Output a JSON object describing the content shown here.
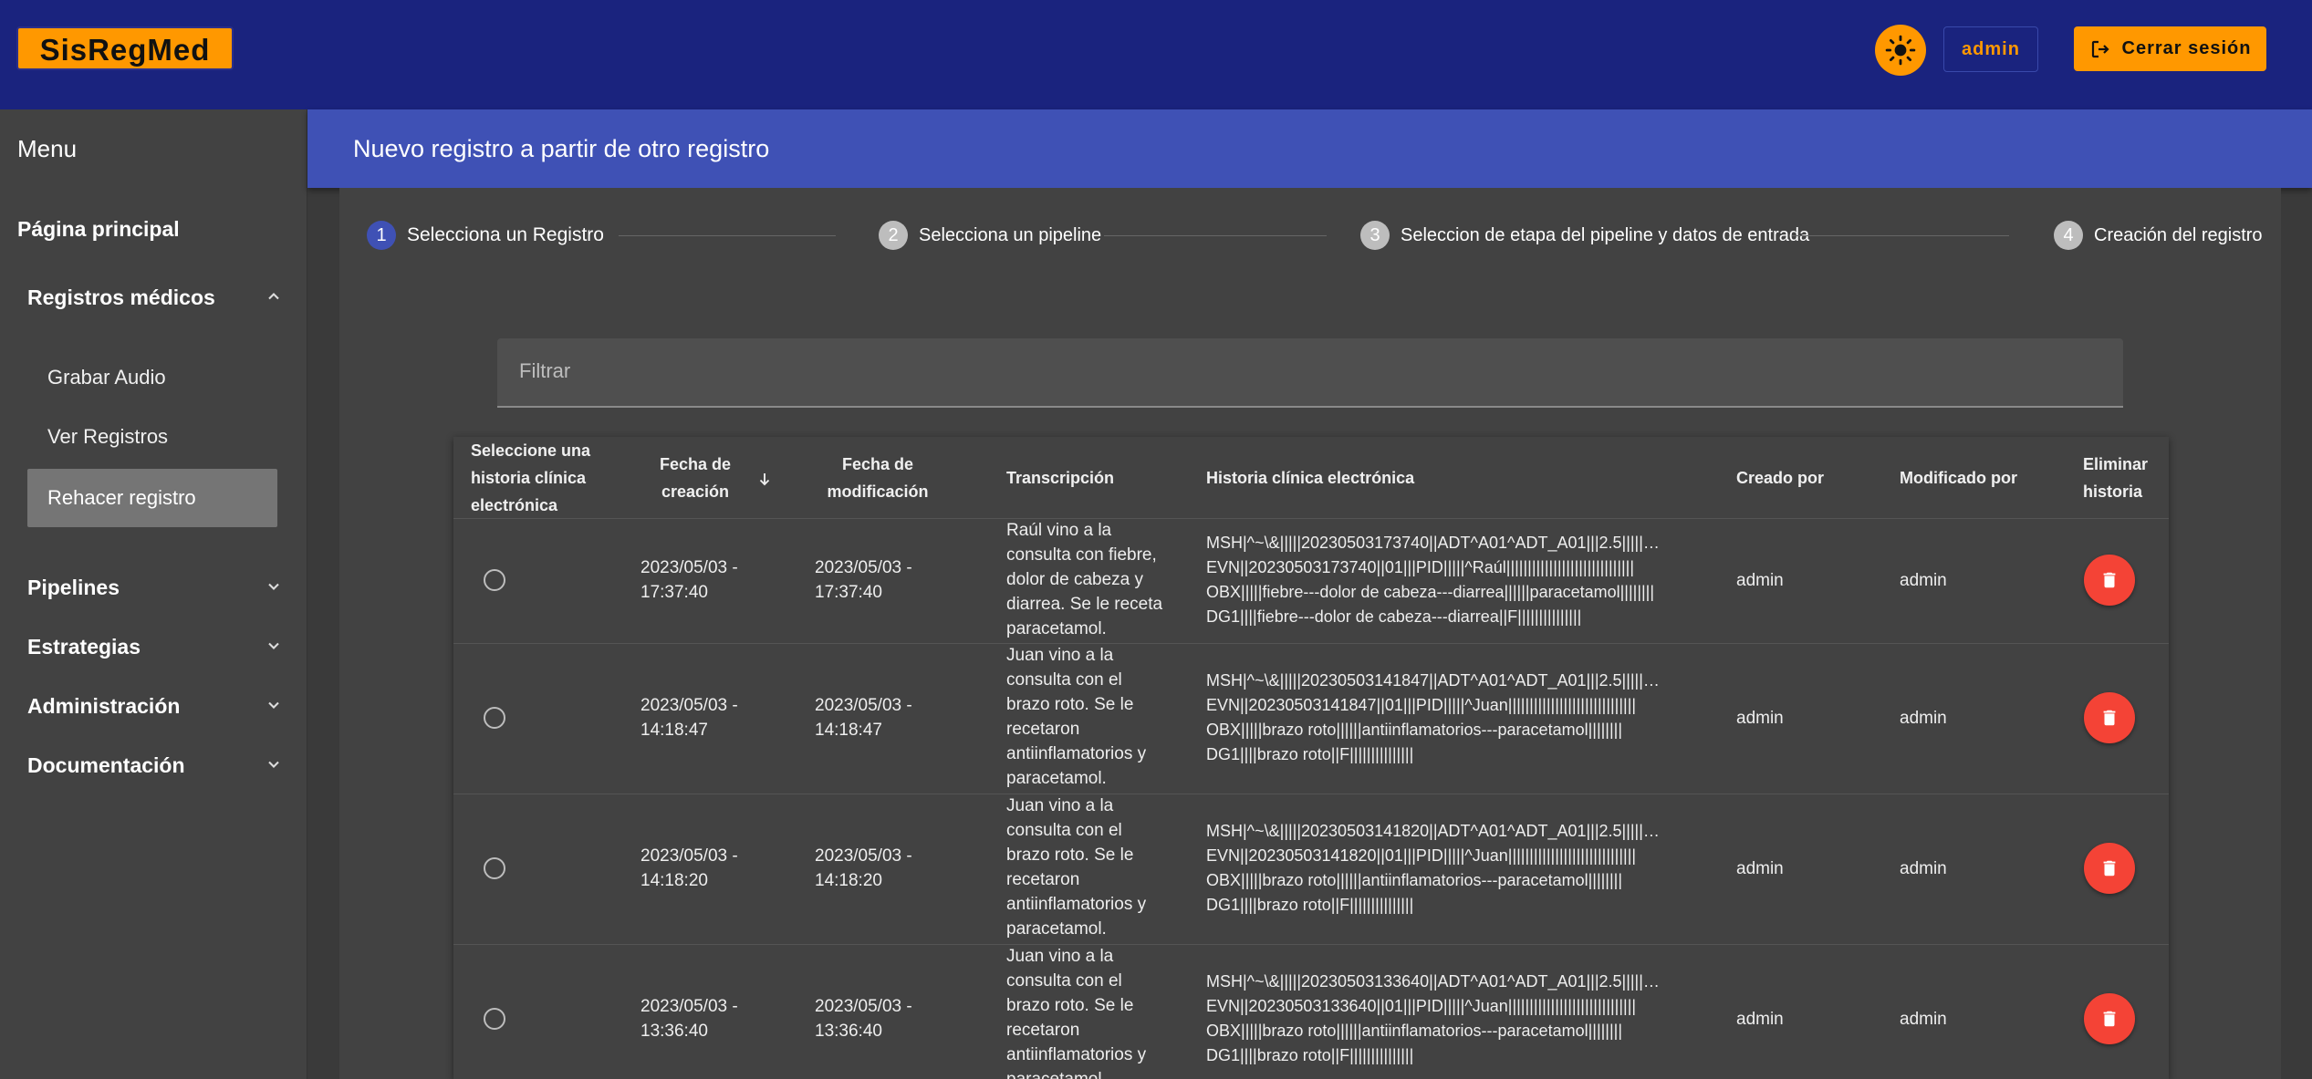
{
  "app": {
    "logo": "SisRegMed"
  },
  "topbar": {
    "user_label": "admin",
    "logout_label": "Cerrar sesión"
  },
  "sidebar": {
    "title": "Menu",
    "main": "Página principal",
    "groups": [
      {
        "label": "Registros médicos",
        "expanded": true,
        "items": [
          "Grabar Audio",
          "Ver Registros",
          "Rehacer registro"
        ],
        "active": "Rehacer registro"
      },
      {
        "label": "Pipelines",
        "expanded": false
      },
      {
        "label": "Estrategias",
        "expanded": false
      },
      {
        "label": "Administración",
        "expanded": false
      },
      {
        "label": "Documentación",
        "expanded": false
      }
    ]
  },
  "page": {
    "title": "Nuevo registro a partir de otro registro"
  },
  "stepper": [
    {
      "num": "1",
      "label": "Selecciona un Registro",
      "active": true
    },
    {
      "num": "2",
      "label": "Selecciona un pipeline",
      "active": false
    },
    {
      "num": "3",
      "label": "Seleccion de etapa del pipeline y datos de entrada",
      "active": false
    },
    {
      "num": "4",
      "label": "Creación del registro",
      "active": false
    }
  ],
  "filter": {
    "placeholder": "Filtrar",
    "value": ""
  },
  "table": {
    "headers": {
      "select": "Seleccione una historia clínica electrónica",
      "created": "Fecha de creación",
      "modified": "Fecha de modificación",
      "transcription": "Transcripción",
      "ehr": "Historia clínica electrónica",
      "created_by": "Creado por",
      "modified_by": "Modificado por",
      "delete": "Eliminar historia"
    },
    "sort": {
      "column": "created",
      "direction": "desc"
    },
    "rows": [
      {
        "created": "2023/05/03 - 17:37:40",
        "modified": "2023/05/03 - 17:37:40",
        "transcription": [
          "Raúl vino a la",
          "consulta con fiebre,",
          "dolor de cabeza y",
          "diarrea. Se le receta",
          "paracetamol."
        ],
        "ehr": [
          "MSH|^~\\&|||||20230503173740||ADT^A01^ADT_A01|||2.5|||||…",
          "EVN||20230503173740||01|||PID|||||^Raúl||||||||||||||||||||||||||||||",
          "OBX|||||fiebre---dolor de cabeza---diarrea||||||paracetamol||||||||",
          "DG1||||fiebre---dolor de cabeza---diarrea||F|||||||||||||||"
        ],
        "created_by": "admin",
        "modified_by": "admin"
      },
      {
        "created": "2023/05/03 - 14:18:47",
        "modified": "2023/05/03 - 14:18:47",
        "transcription": [
          "Juan vino a la",
          "consulta con el",
          "brazo roto. Se le",
          "recetaron",
          "antiinflamatorios y",
          "paracetamol."
        ],
        "ehr": [
          "MSH|^~\\&|||||20230503141847||ADT^A01^ADT_A01|||2.5|||||…",
          "EVN||20230503141847||01|||PID|||||^Juan||||||||||||||||||||||||||||||",
          "OBX|||||brazo roto||||||antiinflamatorios---paracetamol||||||||",
          "DG1||||brazo roto||F|||||||||||||||"
        ],
        "created_by": "admin",
        "modified_by": "admin"
      },
      {
        "created": "2023/05/03 - 14:18:20",
        "modified": "2023/05/03 - 14:18:20",
        "transcription": [
          "Juan vino a la",
          "consulta con el",
          "brazo roto. Se le",
          "recetaron",
          "antiinflamatorios y",
          "paracetamol."
        ],
        "ehr": [
          "MSH|^~\\&|||||20230503141820||ADT^A01^ADT_A01|||2.5|||||…",
          "EVN||20230503141820||01|||PID|||||^Juan||||||||||||||||||||||||||||||",
          "OBX|||||brazo roto||||||antiinflamatorios---paracetamol||||||||",
          "DG1||||brazo roto||F|||||||||||||||"
        ],
        "created_by": "admin",
        "modified_by": "admin"
      },
      {
        "created": "2023/05/03 - 13:36:40",
        "modified": "2023/05/03 - 13:36:40",
        "transcription": [
          "Juan vino a la",
          "consulta con el",
          "brazo roto. Se le",
          "recetaron",
          "antiinflamatorios y",
          "paracetamol."
        ],
        "ehr": [
          "MSH|^~\\&|||||20230503133640||ADT^A01^ADT_A01|||2.5|||||…",
          "EVN||20230503133640||01|||PID|||||^Juan||||||||||||||||||||||||||||||",
          "OBX|||||brazo roto||||||antiinflamatorios---paracetamol||||||||",
          "DG1||||brazo roto||F|||||||||||||||"
        ],
        "created_by": "admin",
        "modified_by": "admin"
      }
    ]
  },
  "colors": {
    "topbar": "#1a237e",
    "accent": "#ff9800",
    "header": "#3f51b5",
    "delete": "#f44336"
  },
  "icons": {
    "theme": "sun-icon",
    "logout": "logout-icon",
    "delete": "trash-icon",
    "sort": "arrow-down-icon",
    "chevron": "chevron-icon"
  }
}
